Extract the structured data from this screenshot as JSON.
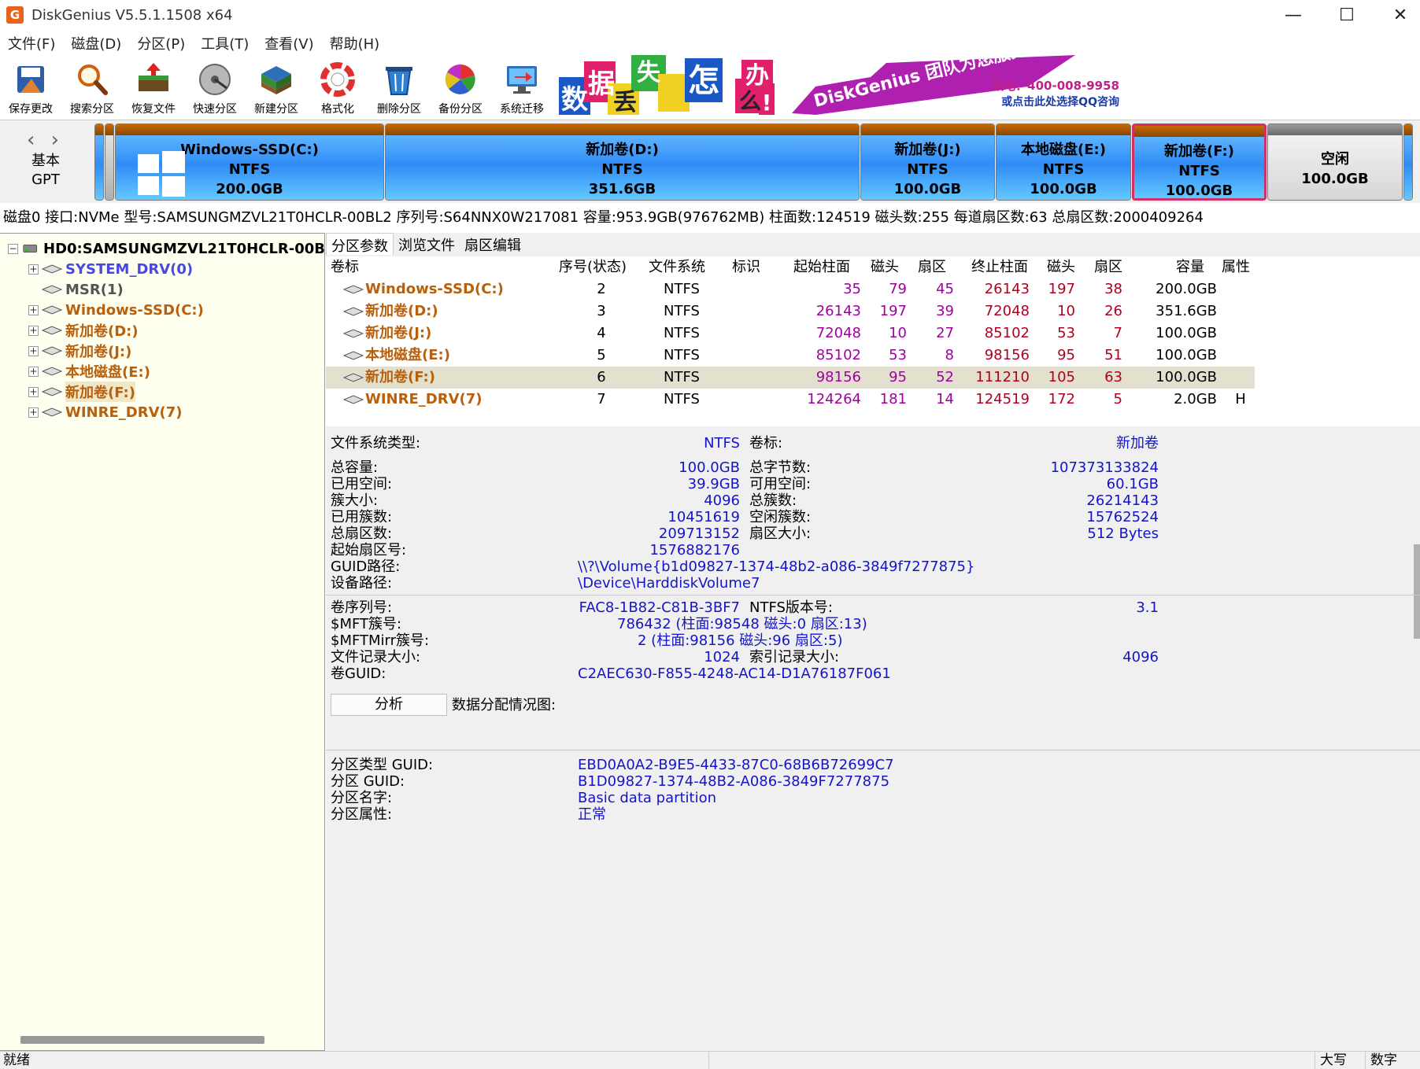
{
  "window": {
    "title": "DiskGenius V5.5.1.1508 x64",
    "logo_glyph": "G",
    "minimize": "—",
    "maximize": "☐",
    "close": "✕"
  },
  "menu": [
    "文件(F)",
    "磁盘(D)",
    "分区(P)",
    "工具(T)",
    "查看(V)",
    "帮助(H)"
  ],
  "toolbar": {
    "buttons": [
      {
        "label": "保存更改",
        "icon": "save-icon"
      },
      {
        "label": "搜索分区",
        "icon": "search-icon"
      },
      {
        "label": "恢复文件",
        "icon": "recover-files-icon"
      },
      {
        "label": "快速分区",
        "icon": "quick-partition-icon"
      },
      {
        "label": "新建分区",
        "icon": "new-partition-icon"
      },
      {
        "label": "格式化",
        "icon": "format-icon"
      },
      {
        "label": "删除分区",
        "icon": "delete-partition-icon"
      },
      {
        "label": "备份分区",
        "icon": "backup-partition-icon"
      },
      {
        "label": "系统迁移",
        "icon": "system-migration-icon"
      }
    ]
  },
  "banner": {
    "chars": [
      "数",
      "据",
      "丢",
      "失",
      "怎",
      "么",
      "办",
      "!"
    ],
    "brand": "DiskGenius 团队为您服务",
    "phone": "致电：400-008-9958",
    "qq": "或点击此处选择QQ咨询"
  },
  "disk_strip": {
    "nav": "‹ ›",
    "kind_line1": "基本",
    "kind_line2": "GPT",
    "partitions": [
      {
        "name": "Windows-SSD(C:)",
        "fs": "NTFS",
        "size": "200.0GB"
      },
      {
        "name": "新加卷(D:)",
        "fs": "NTFS",
        "size": "351.6GB"
      },
      {
        "name": "新加卷(J:)",
        "fs": "NTFS",
        "size": "100.0GB"
      },
      {
        "name": "本地磁盘(E:)",
        "fs": "NTFS",
        "size": "100.0GB"
      },
      {
        "name": "新加卷(F:)",
        "fs": "NTFS",
        "size": "100.0GB"
      },
      {
        "name": "空闲",
        "fs": "",
        "size": "100.0GB"
      }
    ]
  },
  "disk_info": "磁盘0 接口:NVMe  型号:SAMSUNGMZVL21T0HCLR-00BL2  序列号:S64NNX0W217081  容量:953.9GB(976762MB)  柱面数:124519  磁头数:255  每道扇区数:63  总扇区数:2000409264",
  "tree": {
    "root": "HD0:SAMSUNGMZVL21T0HCLR-00BL2",
    "items": [
      {
        "label": "SYSTEM_DRV(0)",
        "color": "#4848e0",
        "expandable": true
      },
      {
        "label": "MSR(1)",
        "color": "#555555",
        "expandable": false
      },
      {
        "label": "Windows-SSD(C:)",
        "color": "#b8600c",
        "expandable": true
      },
      {
        "label": "新加卷(D:)",
        "color": "#b8600c",
        "expandable": true
      },
      {
        "label": "新加卷(J:)",
        "color": "#b8600c",
        "expandable": true
      },
      {
        "label": "本地磁盘(E:)",
        "color": "#b8600c",
        "expandable": true
      },
      {
        "label": "新加卷(F:)",
        "color": "#b8600c",
        "expandable": true,
        "selected": true
      },
      {
        "label": "WINRE_DRV(7)",
        "color": "#b8600c",
        "expandable": true
      }
    ],
    "expand_glyph": "+",
    "collapse_glyph": "−"
  },
  "tabs": [
    "分区参数",
    "浏览文件",
    "扇区编辑"
  ],
  "partition_table": {
    "headers": [
      "卷标",
      "序号(状态)",
      "文件系统",
      "标识",
      "起始柱面",
      "磁头",
      "扇区",
      "终止柱面",
      "磁头",
      "扇区",
      "容量",
      "属性"
    ],
    "rows": [
      [
        "Windows-SSD(C:)",
        "2",
        "NTFS",
        "",
        "35",
        "79",
        "45",
        "26143",
        "197",
        "38",
        "200.0GB",
        ""
      ],
      [
        "新加卷(D:)",
        "3",
        "NTFS",
        "",
        "26143",
        "197",
        "39",
        "72048",
        "10",
        "26",
        "351.6GB",
        ""
      ],
      [
        "新加卷(J:)",
        "4",
        "NTFS",
        "",
        "72048",
        "10",
        "27",
        "85102",
        "53",
        "7",
        "100.0GB",
        ""
      ],
      [
        "本地磁盘(E:)",
        "5",
        "NTFS",
        "",
        "85102",
        "53",
        "8",
        "98156",
        "95",
        "51",
        "100.0GB",
        ""
      ],
      [
        "新加卷(F:)",
        "6",
        "NTFS",
        "",
        "98156",
        "95",
        "52",
        "111210",
        "105",
        "63",
        "100.0GB",
        ""
      ],
      [
        "WINRE_DRV(7)",
        "7",
        "NTFS",
        "",
        "124264",
        "181",
        "14",
        "124519",
        "172",
        "5",
        "2.0GB",
        "H"
      ]
    ],
    "selected_row": 4
  },
  "details": {
    "fs_type_label": "文件系统类型:",
    "fs_type": "NTFS",
    "volume_label_label": "卷标:",
    "volume_label": "新加卷",
    "total_capacity_label": "总容量:",
    "total_capacity": "100.0GB",
    "total_bytes_label": "总字节数:",
    "total_bytes": "107373133824",
    "used_space_label": "已用空间:",
    "used_space": "39.9GB",
    "free_space_label": "可用空间:",
    "free_space": "60.1GB",
    "cluster_size_label": "簇大小:",
    "cluster_size": "4096",
    "total_clusters_label": "总簇数:",
    "total_clusters": "26214143",
    "used_clusters_label": "已用簇数:",
    "used_clusters": "10451619",
    "free_clusters_label": "空闲簇数:",
    "free_clusters": "15762524",
    "total_sectors_label": "总扇区数:",
    "total_sectors": "209713152",
    "sector_size_label": "扇区大小:",
    "sector_size": "512 Bytes",
    "start_sector_label": "起始扇区号:",
    "start_sector": "1576882176",
    "guid_path_label": "GUID路径:",
    "guid_path": "\\\\?\\Volume{b1d09827-1374-48b2-a086-3849f7277875}",
    "device_path_label": "设备路径:",
    "device_path": "\\Device\\HarddiskVolume7",
    "serial_label": "卷序列号:",
    "serial": "FAC8-1B82-C81B-3BF7",
    "ntfs_version_label": "NTFS版本号:",
    "ntfs_version": "3.1",
    "mft_label": "$MFT簇号:",
    "mft": "786432 (柱面:98548 磁头:0 扇区:13)",
    "mftmirr_label": "$MFTMirr簇号:",
    "mftmirr": "2 (柱面:98156 磁头:96 扇区:5)",
    "file_record_label": "文件记录大小:",
    "file_record": "1024",
    "index_record_label": "索引记录大小:",
    "index_record": "4096",
    "volume_guid_label": "卷GUID:",
    "volume_guid": "C2AEC630-F855-4248-AC14-D1A76187F061",
    "analyze_button": "分析",
    "allocation_label": "数据分配情况图:",
    "type_guid_label": "分区类型 GUID:",
    "type_guid": "EBD0A0A2-B9E5-4433-87C0-68B6B72699C7",
    "part_guid_label": "分区 GUID:",
    "part_guid": "B1D09827-1374-48B2-A086-3849F7277875",
    "part_name_label": "分区名字:",
    "part_name": "Basic data partition",
    "part_attr_label": "分区属性:",
    "part_attr": "正常"
  },
  "status": {
    "text": "就绪",
    "caps": "大写",
    "num": "数字"
  },
  "colors": {
    "partition_name": "#b8600c",
    "system_drv": "#4848e0",
    "value_blue": "#1414c8",
    "value_magenta": "#a000a0",
    "value_red": "#b00020",
    "selected_partition_border": "#d0306a",
    "tree_background": "#fffff0"
  }
}
